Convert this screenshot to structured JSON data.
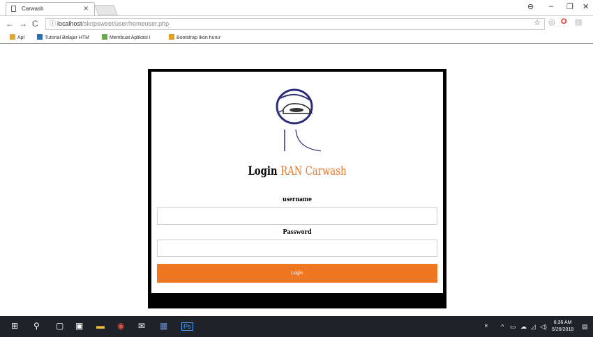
{
  "browser": {
    "tab_title": "Carwash",
    "url_host": "localhost",
    "url_path": "/skripsweet/user/homeuser.php",
    "bookmarks": [
      {
        "label": "Apl",
        "icon": "apps-grid-icon",
        "color": "#e8a33a"
      },
      {
        "label": "Tutorial Belajar HTM",
        "icon": "di-bookmark-icon",
        "color": "#2b6fb6"
      },
      {
        "label": "Membuat Aplikasi I",
        "icon": "tk-bookmark-icon",
        "color": "#6aa84f"
      },
      {
        "label": "Bootstrap ikon hurur",
        "icon": "bootstrap-bookmark-icon",
        "color": "#e0a020"
      }
    ]
  },
  "login": {
    "title_prefix": "Login",
    "title_brand": "RAN Carwash",
    "username_label": "username",
    "username_value": "",
    "password_label": "Password",
    "password_value": "",
    "submit_label": "Login",
    "accent_color": "#ef7722"
  },
  "taskbar": {
    "time": "6:36 AM",
    "date": "5/26/2018"
  }
}
